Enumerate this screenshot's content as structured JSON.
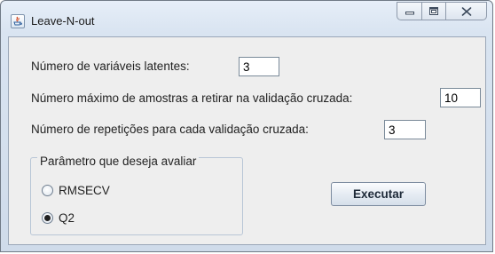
{
  "window": {
    "title": "Leave-N-out",
    "icon": "java-app-icon"
  },
  "form": {
    "latent_label": "Número de variáveis latentes:",
    "latent_value": "3",
    "max_samples_label": "Número máximo de amostras a retirar na validação cruzada:",
    "max_samples_value": "10",
    "repetitions_label": "Número de repetições para cada validação cruzada:",
    "repetitions_value": "3"
  },
  "param_group": {
    "legend": "Parâmetro que deseja avaliar",
    "options": [
      {
        "label": "RMSECV",
        "selected": false
      },
      {
        "label": "Q2",
        "selected": true
      }
    ]
  },
  "actions": {
    "execute_label": "Executar"
  }
}
